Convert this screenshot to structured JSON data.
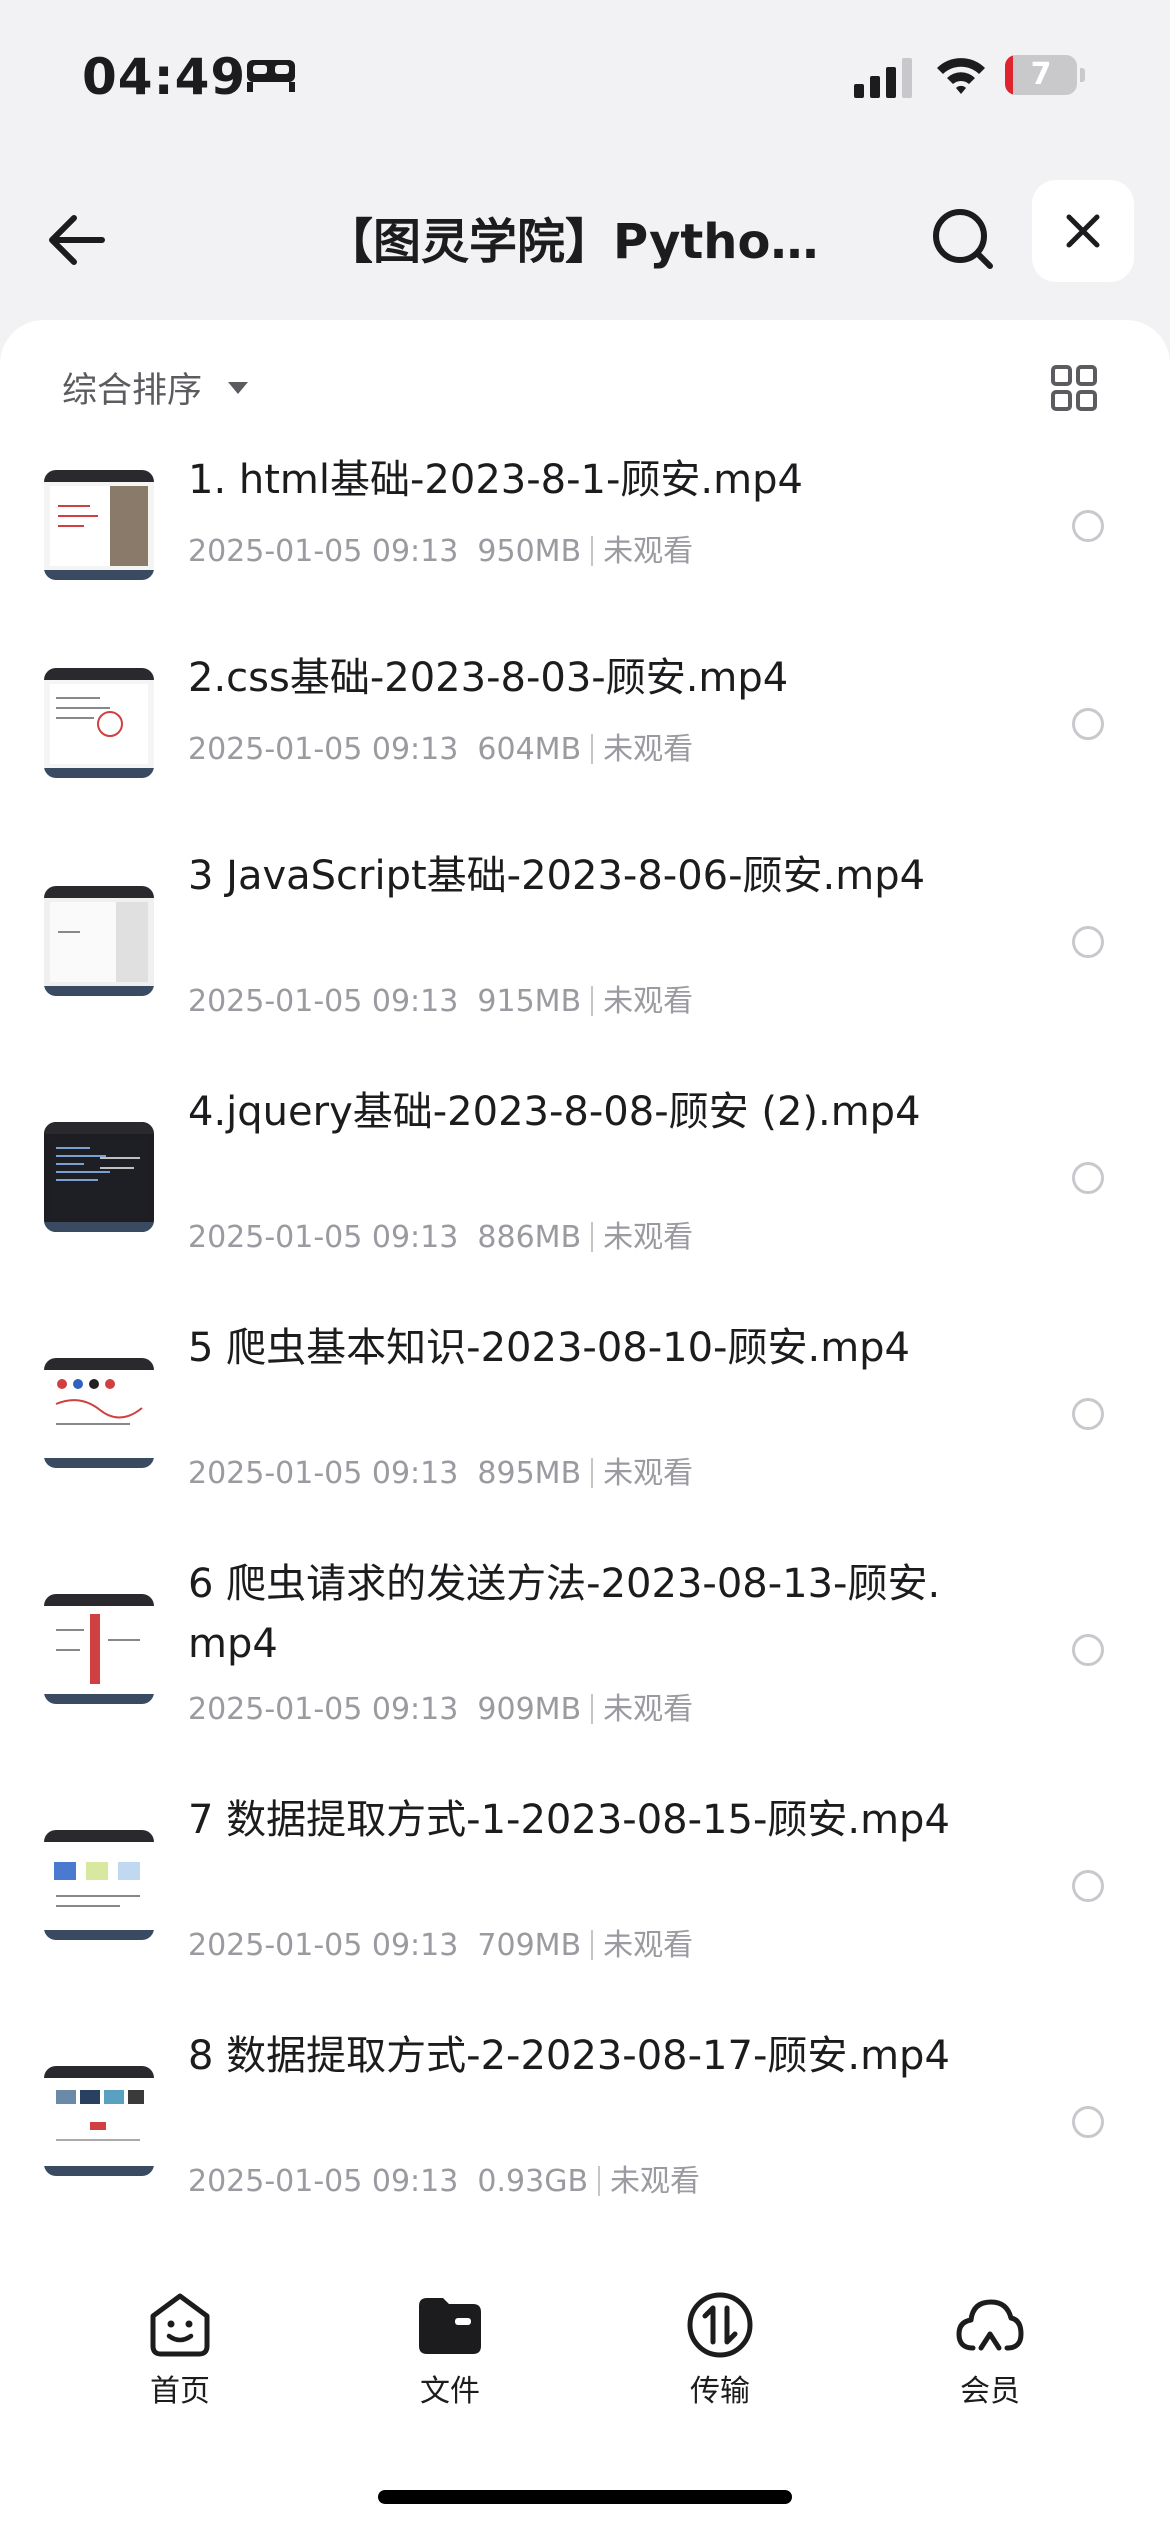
{
  "status_bar": {
    "time": "04:49",
    "battery_level": "7"
  },
  "navbar": {
    "title": "【图灵学院】Python..."
  },
  "toolbar": {
    "sort_label": "综合排序"
  },
  "files": [
    {
      "title": "1. html基础-2023-8-1-顾安.mp4",
      "date": "2025-01-05 09:13",
      "size": "950MB",
      "status": "未观看"
    },
    {
      "title": "2.css基础-2023-8-03-顾安.mp4",
      "date": "2025-01-05 09:13",
      "size": "604MB",
      "status": "未观看"
    },
    {
      "title": "3 JavaScript基础-2023-8-06-顾安.mp4",
      "date": "2025-01-05 09:13",
      "size": "915MB",
      "status": "未观看"
    },
    {
      "title": "4.jquery基础-2023-8-08-顾安 (2).mp4",
      "date": "2025-01-05 09:13",
      "size": "886MB",
      "status": "未观看"
    },
    {
      "title": "5 爬虫基本知识-2023-08-10-顾安.mp4",
      "date": "2025-01-05 09:13",
      "size": "895MB",
      "status": "未观看"
    },
    {
      "title": "6 爬虫请求的发送方法-2023-08-13-顾安.mp4",
      "date": "2025-01-05 09:13",
      "size": "909MB",
      "status": "未观看"
    },
    {
      "title": "7 数据提取方式-1-2023-08-15-顾安.mp4",
      "date": "2025-01-05 09:13",
      "size": "709MB",
      "status": "未观看"
    },
    {
      "title": "8 数据提取方式-2-2023-08-17-顾安.mp4",
      "date": "2025-01-05 09:13",
      "size": "0.93GB",
      "status": "未观看"
    }
  ],
  "tabbar": {
    "home": "首页",
    "files": "文件",
    "transfer": "传输",
    "member": "会员"
  }
}
